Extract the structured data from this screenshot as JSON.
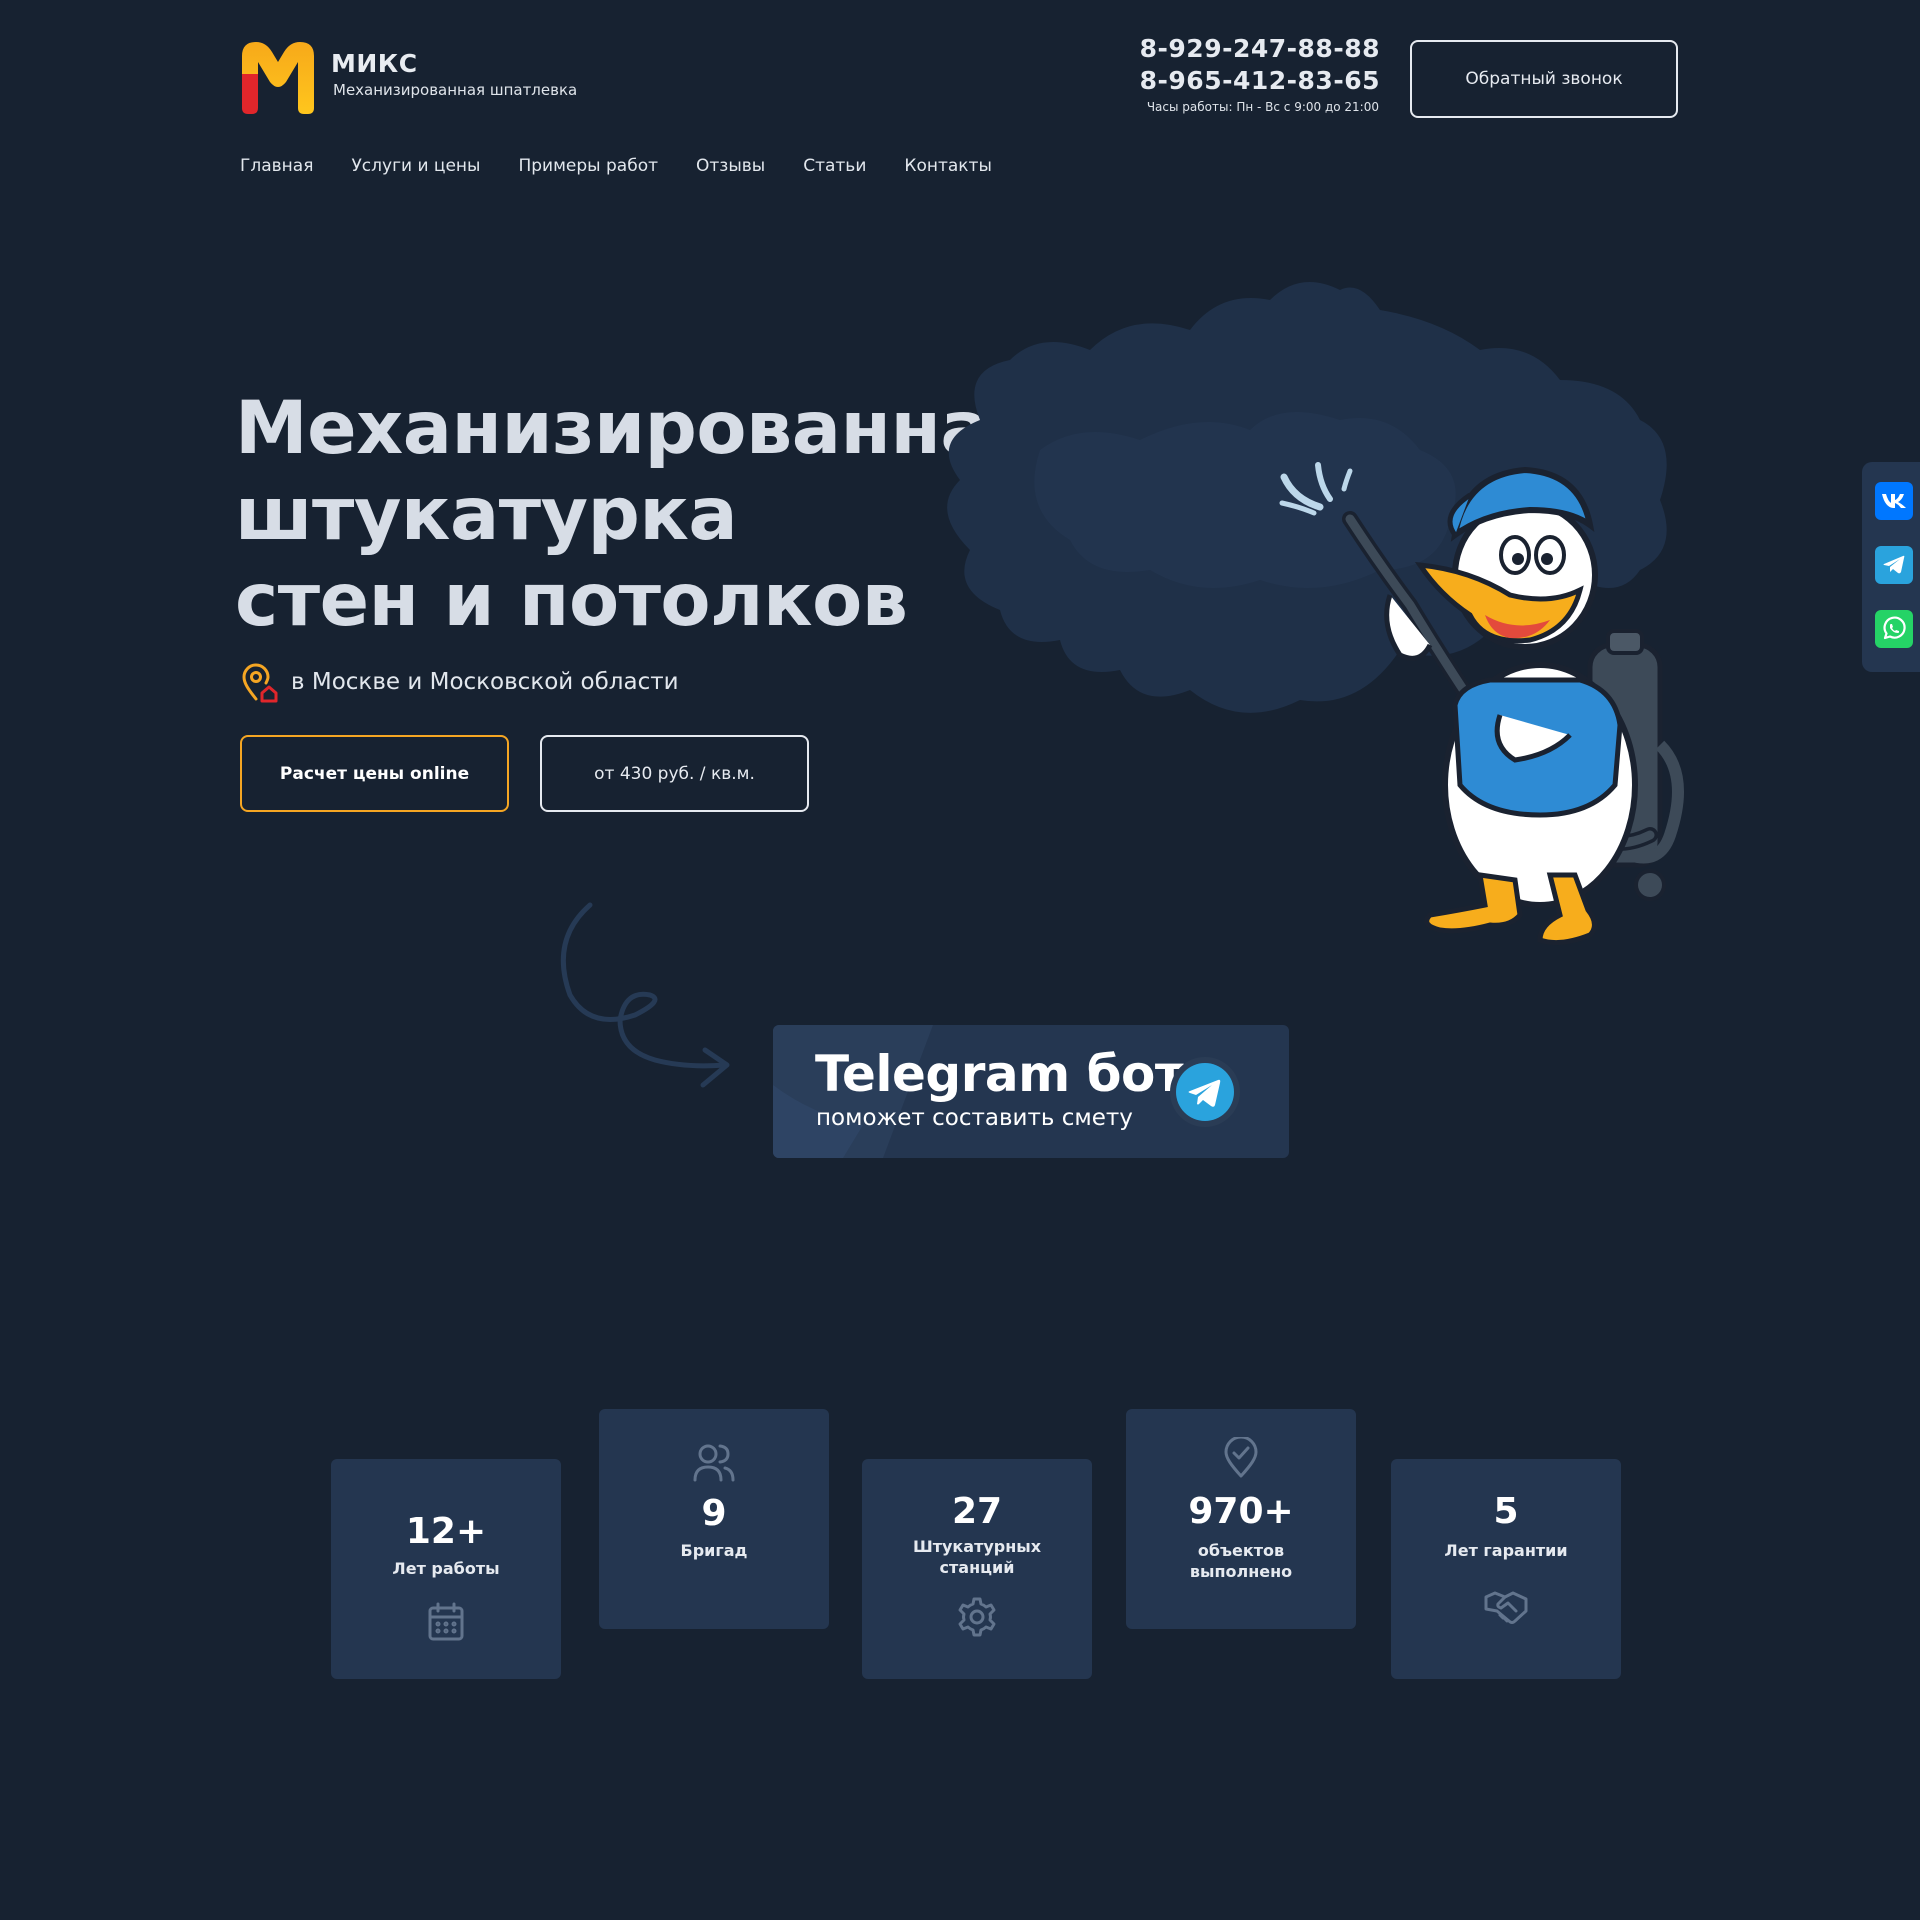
{
  "header": {
    "logo_title": "МИКС",
    "logo_subtitle": "Механизированная шпатлевка",
    "phone_1": "8-929-247-88-88",
    "phone_2": "8-965-412-83-65",
    "hours": "Часы работы: Пн - Вс с 9:00 до 21:00",
    "callback_label": "Обратный звонок"
  },
  "nav": {
    "items": [
      {
        "label": "Главная"
      },
      {
        "label": "Услуги и цены"
      },
      {
        "label": "Примеры работ"
      },
      {
        "label": "Отзывы"
      },
      {
        "label": "Статьи"
      },
      {
        "label": "Контакты"
      }
    ]
  },
  "hero": {
    "title": "Механизированная штукатурка стен и потолков",
    "location": "в Москве и Московской области",
    "calc_button": "Расчет цены online",
    "price_button": "от 430 руб. / кв.м."
  },
  "telegram_card": {
    "title": "Telegram бот",
    "subtitle": "поможет составить смету",
    "icon": "telegram-icon"
  },
  "stats": [
    {
      "value": "12+",
      "label": "Лет работы",
      "icon": "calendar-icon"
    },
    {
      "value": "9",
      "label": "Бригад",
      "icon": "users-icon"
    },
    {
      "value": "27",
      "label": "Штукатурных станций",
      "icon": "gear-icon"
    },
    {
      "value": "970+",
      "label": "объектов выполнено",
      "icon": "map-pin-check-icon"
    },
    {
      "value": "5",
      "label": "Лет гарантии",
      "icon": "handshake-icon"
    }
  ],
  "social": [
    {
      "icon": "vk-icon",
      "color": "#0077ff"
    },
    {
      "icon": "telegram-icon",
      "color": "#2aa3dd"
    },
    {
      "icon": "whatsapp-icon",
      "color": "#25d366"
    }
  ],
  "colors": {
    "background": "#172231",
    "card": "#243650",
    "accent": "#f5a623",
    "logo_red": "#e0262b"
  }
}
